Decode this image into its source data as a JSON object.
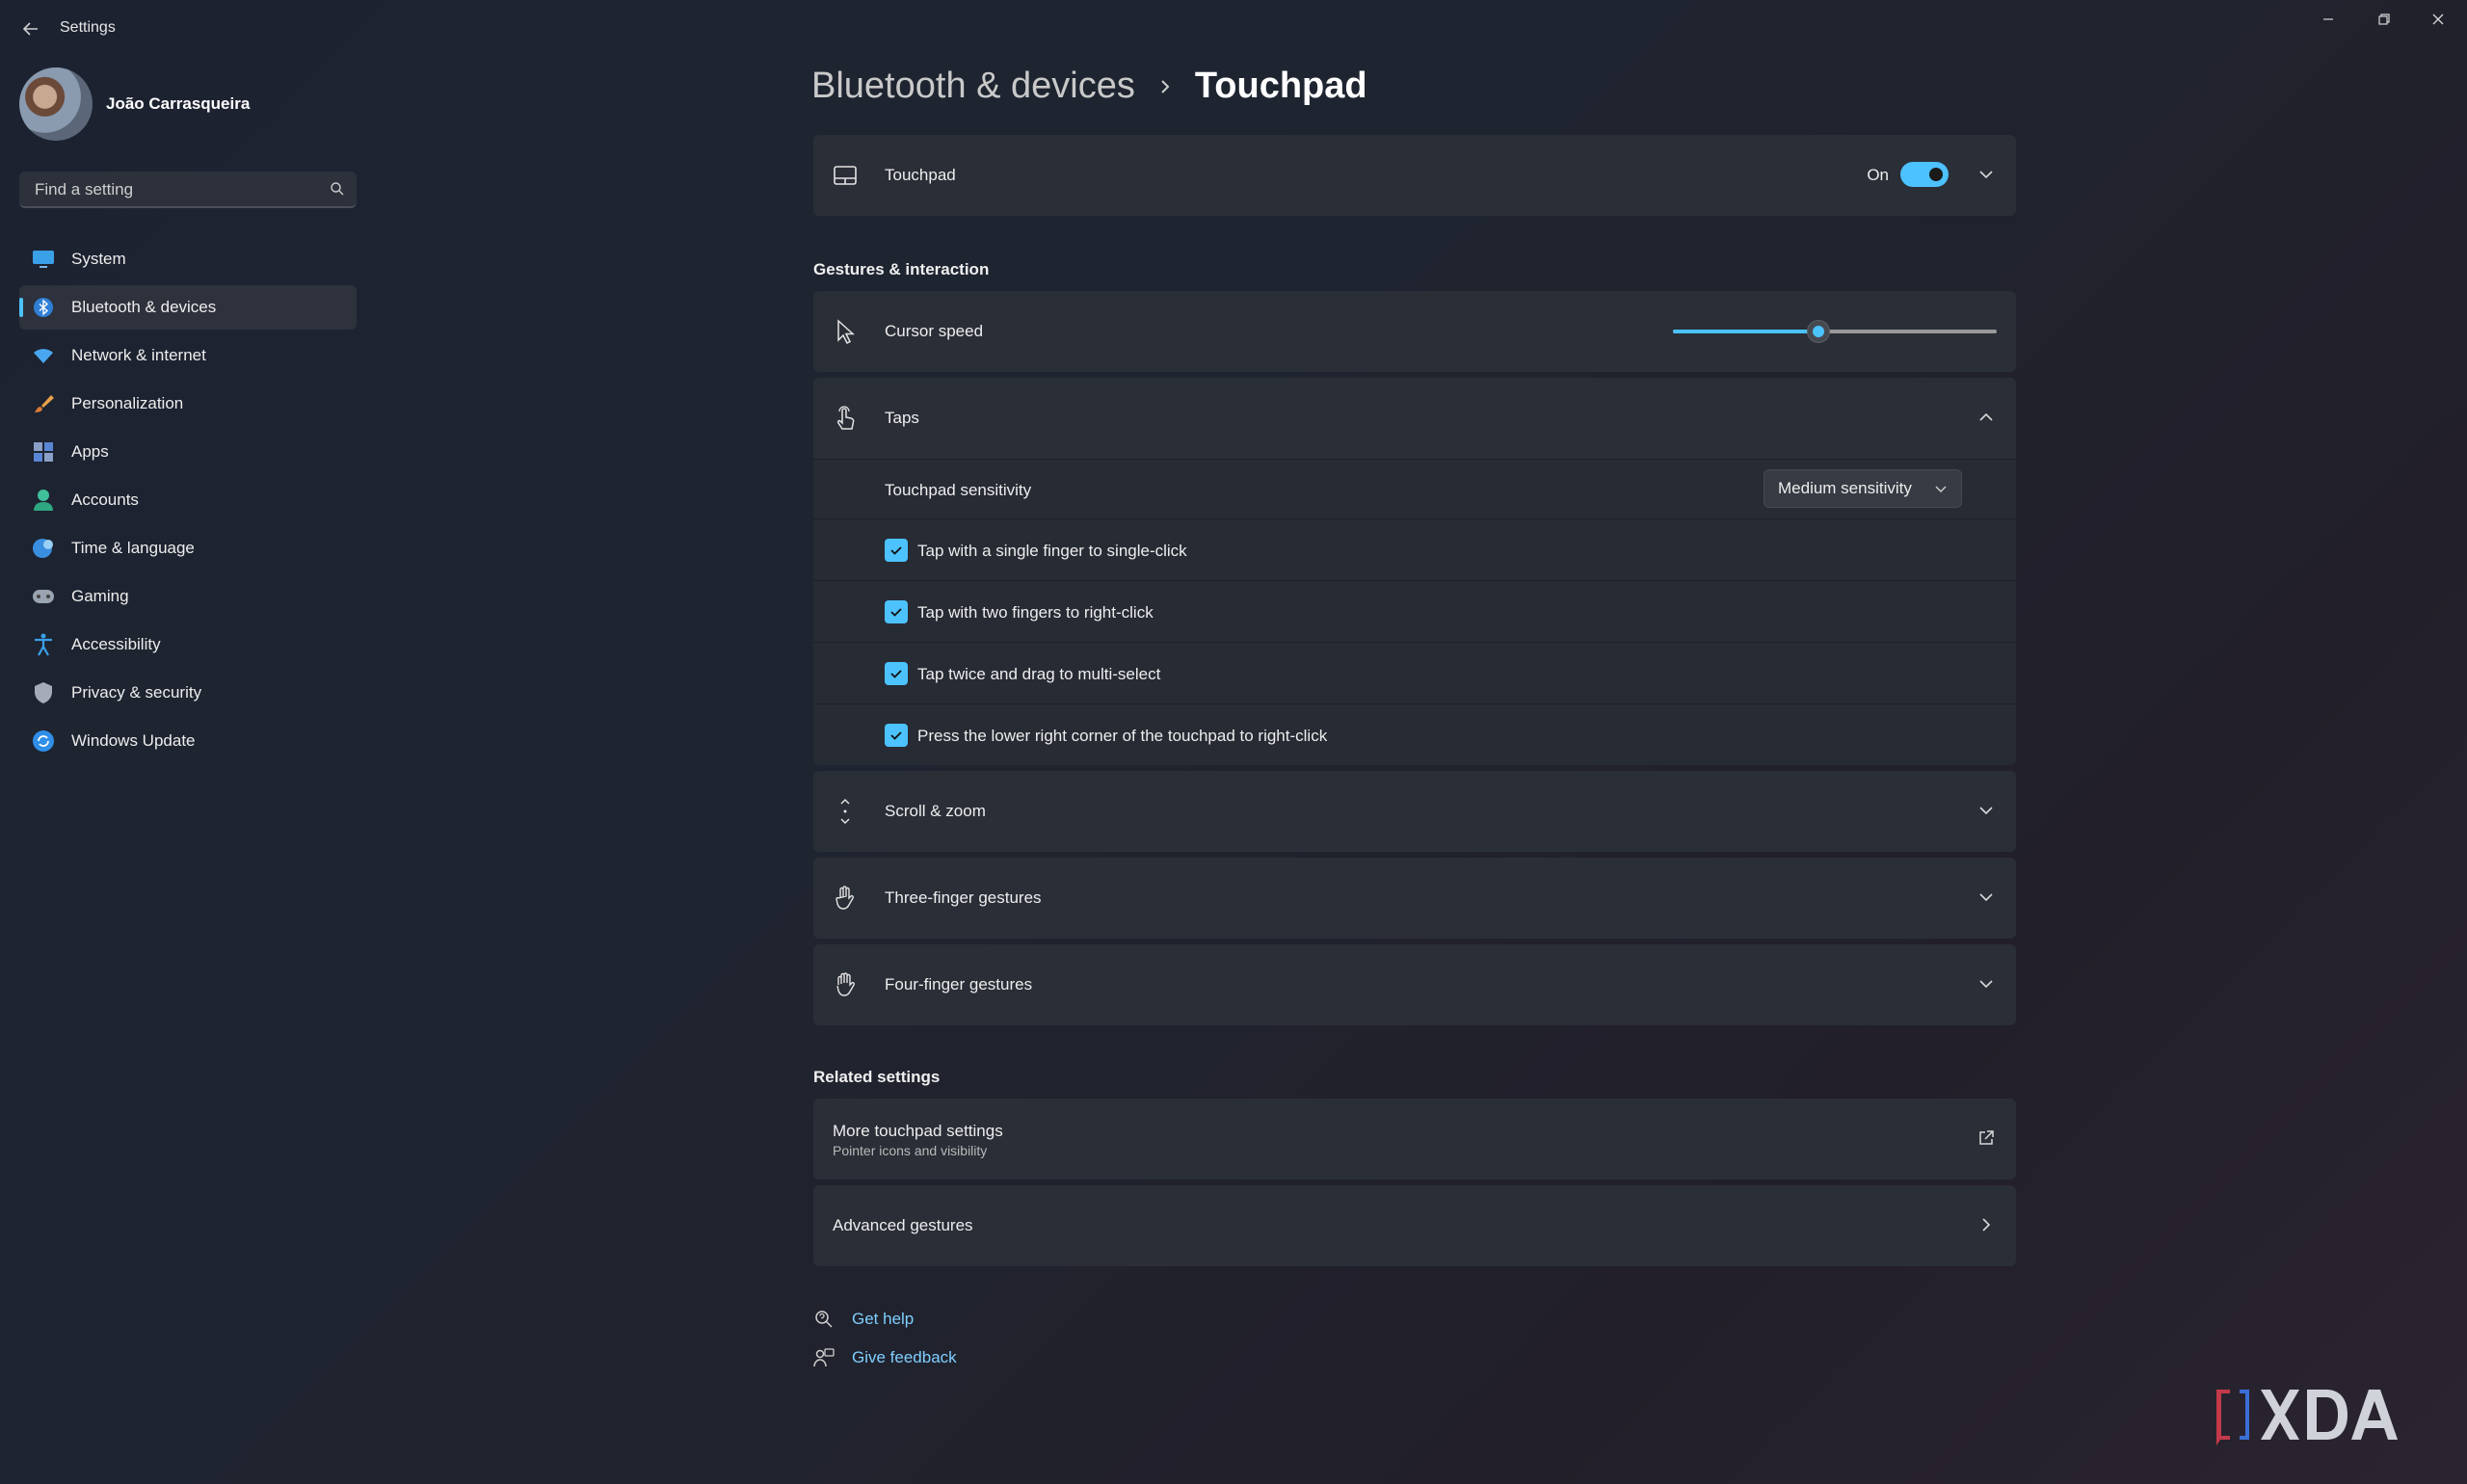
{
  "app": {
    "title": "Settings"
  },
  "profile": {
    "name": "João Carrasqueira"
  },
  "search": {
    "placeholder": "Find a setting"
  },
  "sidebar": {
    "items": [
      {
        "label": "System",
        "icon": "system-icon"
      },
      {
        "label": "Bluetooth & devices",
        "icon": "bluetooth-icon",
        "active": true
      },
      {
        "label": "Network & internet",
        "icon": "wifi-icon"
      },
      {
        "label": "Personalization",
        "icon": "brush-icon"
      },
      {
        "label": "Apps",
        "icon": "apps-icon"
      },
      {
        "label": "Accounts",
        "icon": "account-icon"
      },
      {
        "label": "Time & language",
        "icon": "globe-clock-icon"
      },
      {
        "label": "Gaming",
        "icon": "gamepad-icon"
      },
      {
        "label": "Accessibility",
        "icon": "accessibility-icon"
      },
      {
        "label": "Privacy & security",
        "icon": "shield-icon"
      },
      {
        "label": "Windows Update",
        "icon": "update-icon"
      }
    ]
  },
  "breadcrumb": {
    "parent": "Bluetooth & devices",
    "current": "Touchpad"
  },
  "touchpad": {
    "label": "Touchpad",
    "toggle_text": "On",
    "toggle_on": true
  },
  "gestures": {
    "title": "Gestures & interaction",
    "cursor_speed": {
      "label": "Cursor speed",
      "value_fraction": 0.45
    },
    "taps": {
      "label": "Taps",
      "sensitivity_label": "Touchpad sensitivity",
      "sensitivity_value": "Medium sensitivity",
      "options": [
        {
          "label": "Tap with a single finger to single-click",
          "checked": true
        },
        {
          "label": "Tap with two fingers to right-click",
          "checked": true
        },
        {
          "label": "Tap twice and drag to multi-select",
          "checked": true
        },
        {
          "label": "Press the lower right corner of the touchpad to right-click",
          "checked": true
        }
      ]
    },
    "scroll_zoom": "Scroll & zoom",
    "three_finger": "Three-finger gestures",
    "four_finger": "Four-finger gestures"
  },
  "related": {
    "title": "Related settings",
    "more_touchpad": {
      "label": "More touchpad settings",
      "subtitle": "Pointer icons and visibility"
    },
    "advanced": "Advanced gestures"
  },
  "links": {
    "help": "Get help",
    "feedback": "Give feedback"
  },
  "colors": {
    "accent": "#4cc2ff",
    "background": "#1f2530",
    "card": "#2a2e37"
  }
}
